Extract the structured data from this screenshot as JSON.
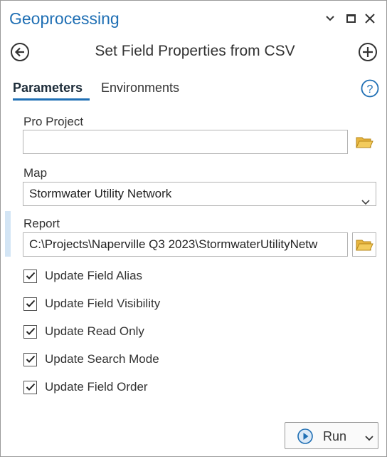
{
  "titlebar": {
    "title": "Geoprocessing",
    "menu_icon": "chevron-down-icon",
    "maximize_icon": "maximize-icon",
    "close_icon": "close-icon"
  },
  "tool": {
    "title": "Set Field Properties from CSV",
    "back_icon": "back-arrow-icon",
    "add_icon": "add-circle-icon"
  },
  "tabs": [
    {
      "label": "Parameters",
      "active": true
    },
    {
      "label": "Environments",
      "active": false
    }
  ],
  "help_icon": "help-icon",
  "fields": {
    "pro_project": {
      "label": "Pro Project",
      "value": ""
    },
    "map": {
      "label": "Map",
      "value": "Stormwater Utility Network"
    },
    "report": {
      "label": "Report",
      "value": "C:\\Projects\\Naperville Q3 2023\\StormwaterUtilityNetw"
    }
  },
  "checkboxes": [
    {
      "label": "Update Field Alias",
      "checked": true
    },
    {
      "label": "Update Field Visibility",
      "checked": true
    },
    {
      "label": "Update Read Only",
      "checked": true
    },
    {
      "label": "Update Search Mode",
      "checked": true
    },
    {
      "label": "Update Field Order",
      "checked": true
    }
  ],
  "run": {
    "label": "Run"
  },
  "colors": {
    "accent": "#1f6fb4",
    "folder": "#e8b640"
  }
}
